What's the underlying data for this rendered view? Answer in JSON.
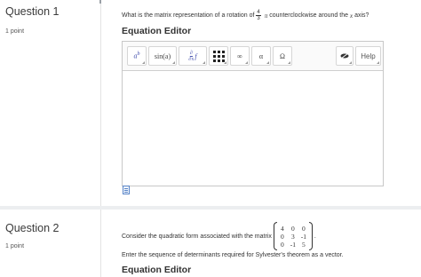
{
  "q1": {
    "title": "Question 1",
    "points": "1 point",
    "prompt_before": "What is the matrix representation of a rotation of",
    "frac_num": "4",
    "frac_den": "3",
    "pi": "π",
    "prompt_after": "counterclockwise around the",
    "axis_var": "x",
    "prompt_end": "axis?",
    "editor_title": "Equation Editor",
    "toolbar": {
      "power_base": "a",
      "power_exp": "b",
      "sin_label": "sin(a)",
      "deriv_num": "∂",
      "deriv_den": "∂x",
      "deriv_f": "f",
      "infinity": "∞",
      "alpha": "α",
      "omega": "Ω",
      "help": "Help"
    }
  },
  "q2": {
    "title": "Question 2",
    "points": "1 point",
    "prompt_before": "Consider the quadratic form associated with the matrix",
    "matrix": [
      [
        "4",
        "0",
        "0"
      ],
      [
        "0",
        "3",
        "-1"
      ],
      [
        "0",
        "-1",
        "5"
      ]
    ],
    "prompt_end": ".",
    "line2": "Enter the sequence of determinants required for Sylvester's theorem as a vector.",
    "editor_title": "Equation Editor"
  }
}
